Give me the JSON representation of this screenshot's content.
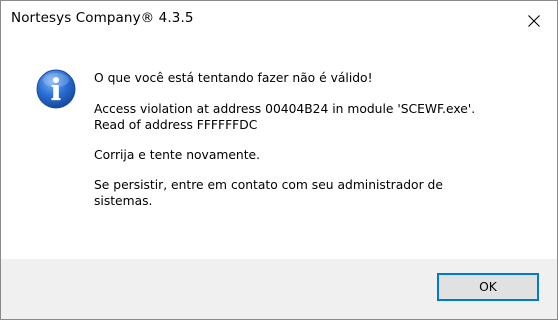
{
  "window": {
    "title": "Nortesys Company® 4.3.5"
  },
  "dialog": {
    "icon": "info-icon",
    "headline": "O que você está tentando fazer não é válido!",
    "error_detail": "Access violation at address 00404B24 in module 'SCEWF.exe'.\nRead of address FFFFFFDC",
    "retry_hint": "Corrija e tente novamente.",
    "contact_hint": "Se persistir, entre em contato com seu administrador de\nsistemas."
  },
  "buttons": {
    "ok_label": "OK"
  },
  "colors": {
    "accent": "#0078d7",
    "footer_bg": "#f0f0f0",
    "icon_blue": "#2a6fd6"
  }
}
